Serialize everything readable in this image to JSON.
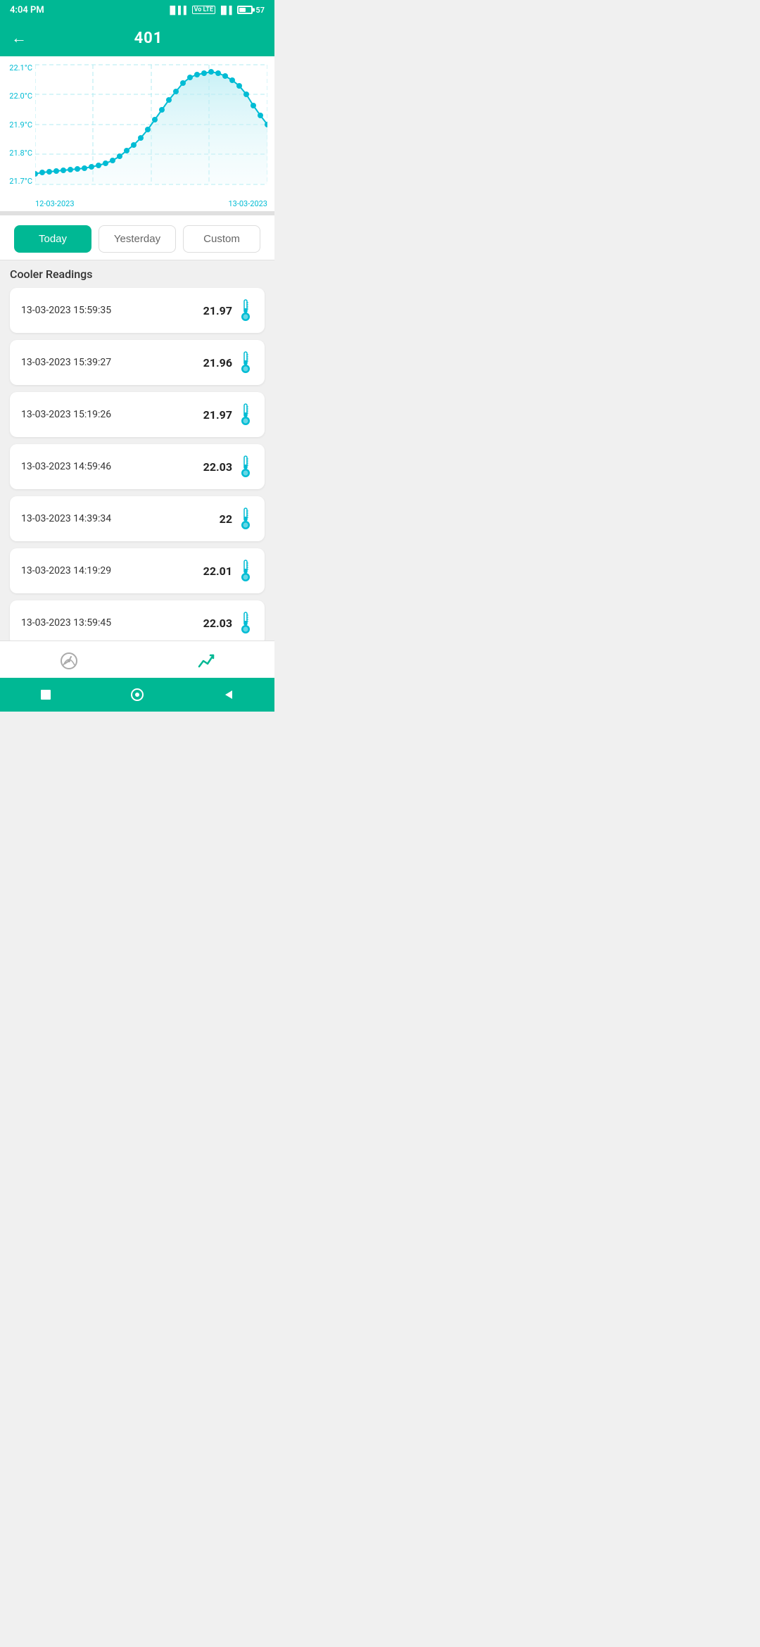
{
  "statusBar": {
    "time": "4:04 PM",
    "battery": "57"
  },
  "header": {
    "title": "401",
    "backLabel": "←"
  },
  "chart": {
    "yLabels": [
      "22.1°C",
      "22.0°C",
      "21.9°C",
      "21.8°C",
      "21.7°C"
    ],
    "xLabels": [
      "12-03-2023",
      "13-03-2023"
    ],
    "accentColor": "#00bcd4"
  },
  "filters": {
    "today": "Today",
    "yesterday": "Yesterday",
    "custom": "Custom"
  },
  "readingsTitle": "Cooler Readings",
  "readings": [
    {
      "datetime": "13-03-2023 15:59:35",
      "value": "21.97"
    },
    {
      "datetime": "13-03-2023 15:39:27",
      "value": "21.96"
    },
    {
      "datetime": "13-03-2023 15:19:26",
      "value": "21.97"
    },
    {
      "datetime": "13-03-2023 14:59:46",
      "value": "22.03"
    },
    {
      "datetime": "13-03-2023 14:39:34",
      "value": "22"
    },
    {
      "datetime": "13-03-2023 14:19:29",
      "value": "22.01"
    },
    {
      "datetime": "13-03-2023 13:59:45",
      "value": "22.03"
    }
  ],
  "bottomNav": {
    "dashboardIcon": "🎛️",
    "chartIcon": "📈"
  }
}
